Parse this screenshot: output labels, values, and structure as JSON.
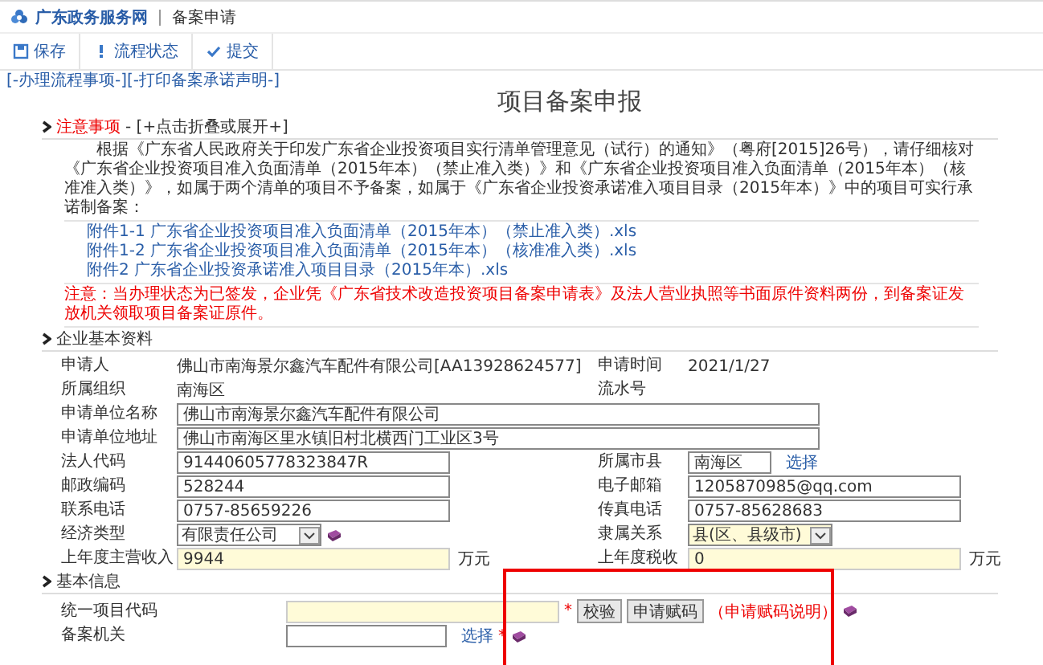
{
  "header": {
    "site": "广东政务服务网",
    "page": "备案申请"
  },
  "toolbar": [
    {
      "kind": "save",
      "label": "保存"
    },
    {
      "kind": "status",
      "label": "流程状态"
    },
    {
      "kind": "submit",
      "label": "提交"
    }
  ],
  "top_links": [
    "[-办理流程事项-]",
    "[-打印备案承诺声明-]"
  ],
  "title": "项目备案申报",
  "notice": {
    "heading": "注意事项",
    "toggle": " - [+点击折叠或展开+]",
    "paragraph": "根据《广东省人民政府关于印发广东省企业投资项目实行清单管理意见（试行）的通知》（粤府[2015]26号），请仔细核对《广东省企业投资项目准入负面清单（2015年本）（禁止准入类）》和《广东省企业投资项目准入负面清单（2015年本）（核准准入类）》，如属于两个清单的项目不予备案，如属于《广东省企业投资承诺准入项目目录（2015年本）》中的项目可实行承诺制备案：",
    "attachments": [
      "附件1-1 广东省企业投资项目准入负面清单（2015年本）（禁止准入类）.xls",
      "附件1-2 广东省企业投资项目准入负面清单（2015年本）（核准准入类）.xls",
      "附件2 广东省企业投资承诺准入项目目录（2015年本）.xls"
    ],
    "warning": "注意：当办理状态为已签发，企业凭《广东省技术改造投资项目备案申请表》及法人营业执照等书面原件资料两份，到备案证发放机关领取项目备案证原件。"
  },
  "sections": [
    {
      "heading": "企业基本资料",
      "rows": [
        {
          "label": "申请人",
          "content": [
            {
              "kind": "text",
              "text": "佛山市南海景尔鑫汽车配件有限公司[AA13928624577]"
            }
          ],
          "label2": "申请时间",
          "content2": [
            {
              "kind": "text",
              "text": "2021/1/27"
            }
          ]
        },
        {
          "label": "所属组织",
          "content": [
            {
              "kind": "text",
              "text": "南海区"
            }
          ],
          "label2": "流水号"
        },
        {
          "label": "申请单位名称",
          "content": [
            {
              "kind": "input_long",
              "value": "佛山市南海景尔鑫汽车配件有限公司",
              "highlighted": false
            }
          ]
        },
        {
          "label": "申请单位地址",
          "content": [
            {
              "kind": "input_long",
              "value": "佛山市南海区里水镇旧村北横西门工业区3号",
              "highlighted": false
            }
          ]
        },
        {
          "label": "法人代码",
          "content": [
            {
              "kind": "input",
              "value": "91440605778323847R",
              "highlighted": false
            }
          ],
          "label2": "所属市县",
          "content2": [
            {
              "kind": "input_short",
              "value": "南海区",
              "highlighted": false
            },
            {
              "kind": "link",
              "text": "选择"
            }
          ]
        },
        {
          "label": "邮政编码",
          "content": [
            {
              "kind": "input",
              "value": "528244",
              "highlighted": false
            }
          ],
          "label2": "电子邮箱",
          "content2": [
            {
              "kind": "input",
              "value": "1205870985@qq.com",
              "highlighted": false
            }
          ]
        },
        {
          "label": "联系电话",
          "content": [
            {
              "kind": "input",
              "value": "0757-85659226",
              "highlighted": false
            }
          ],
          "label2": "传真电话",
          "content2": [
            {
              "kind": "input",
              "value": "0757-85628683",
              "highlighted": false
            }
          ]
        },
        {
          "label": "经济类型",
          "content": [
            {
              "kind": "select",
              "value": "有限责任公司",
              "highlighted": false
            },
            {
              "kind": "icon"
            }
          ],
          "label2": "隶属关系",
          "content2": [
            {
              "kind": "select",
              "value": "县(区、县级市)",
              "highlighted": true
            }
          ]
        },
        {
          "label": "上年度主营收入",
          "content": [
            {
              "kind": "input",
              "value": "9944",
              "highlighted": true
            },
            {
              "kind": "unit",
              "text": "万元"
            }
          ],
          "label2": "上年度税收",
          "content2": [
            {
              "kind": "input",
              "value": "0",
              "highlighted": true
            },
            {
              "kind": "unit",
              "text": "万元"
            }
          ]
        }
      ]
    },
    {
      "heading": "基本信息",
      "rows": [
        {
          "label": "统一项目代码",
          "content": [
            {
              "kind": "input",
              "highlighted": true
            },
            {
              "kind": "required",
              "text": "*"
            },
            {
              "kind": "button",
              "text": "校验"
            },
            {
              "kind": "button",
              "text": "申请赋码"
            },
            {
              "kind": "note",
              "text": "（申请赋码说明）"
            },
            {
              "kind": "icon"
            }
          ]
        },
        {
          "label": "备案机关",
          "content": [
            {
              "kind": "input_medium",
              "highlighted": false
            },
            {
              "kind": "link",
              "text": "选择"
            },
            {
              "kind": "required",
              "text": "*"
            },
            {
              "kind": "icon"
            }
          ]
        }
      ]
    }
  ],
  "markup": [
    {
      "kind": "frame"
    }
  ]
}
